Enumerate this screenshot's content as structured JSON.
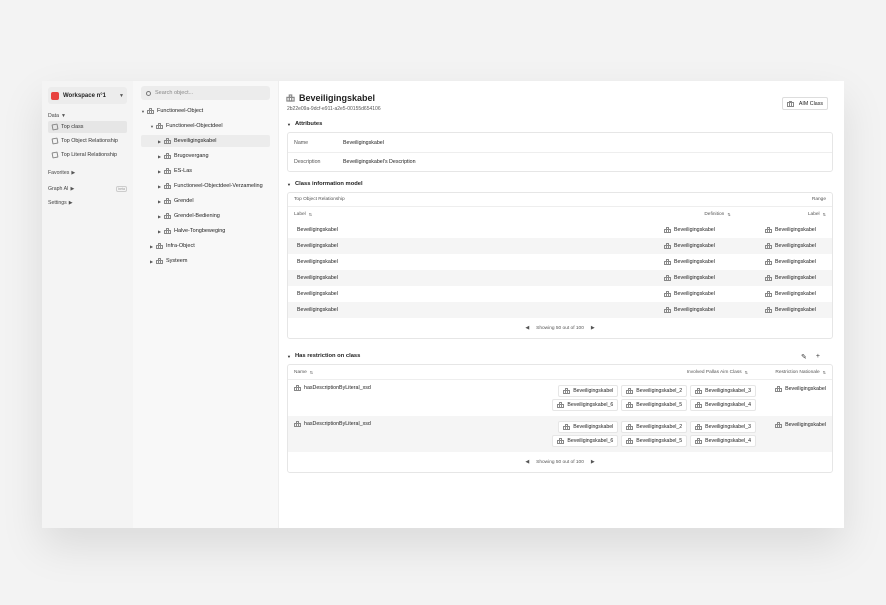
{
  "sidebar": {
    "workspace": "Workspace n°1",
    "data_label": "Data",
    "items": [
      "Top class",
      "Top Object Relationship",
      "Top Literal Relationship"
    ],
    "favorites": "Favorites",
    "graph_ai": "Graph AI",
    "graph_ai_badge": "beta",
    "settings": "Settings"
  },
  "tree": {
    "search_placeholder": "Search object...",
    "root": "Functioneel-Object",
    "child": "Functioneel-Objectdeel",
    "leaves": [
      "Beveiligingskabel",
      "Brugovergang",
      "ES-Las",
      "Functioneel-Objectdeel-Verzameling",
      "Grendel",
      "Grendel-Bediening",
      "Halve-Tongbeweging"
    ],
    "siblings": [
      "Infra-Object",
      "Systeem"
    ]
  },
  "main": {
    "title": "Beveiligingskabel",
    "uuid": "2b22e09a-9dcf-e911-a2e5-00155d654106",
    "aim_button": "AIM Class",
    "attributes": {
      "heading": "Attributes",
      "name_key": "Name",
      "name_val": "Beveiligingskabel",
      "desc_key": "Description",
      "desc_val": "Beveiligingskabel's Description"
    },
    "cim": {
      "heading": "Class information model",
      "sub_left": "Top Object Relationship",
      "sub_right": "Range",
      "col_label": "Label",
      "col_definition": "Definition",
      "col_label2": "Label",
      "rows": [
        [
          "Beveiligingskabel",
          "Beveiligingskabel",
          "Beveiligingskabel"
        ],
        [
          "Beveiligingskabel",
          "Beveiligingskabel",
          "Beveiligingskabel"
        ],
        [
          "Beveiligingskabel",
          "Beveiligingskabel",
          "Beveiligingskabel"
        ],
        [
          "Beveiligingskabel",
          "Beveiligingskabel",
          "Beveiligingskabel"
        ],
        [
          "Beveiligingskabel",
          "Beveiligingskabel",
          "Beveiligingskabel"
        ],
        [
          "Beveiligingskabel",
          "Beveiligingskabel",
          "Beveiligingskabel"
        ]
      ],
      "pager": "Showing 50 out of 100"
    },
    "restriction": {
      "heading": "Has restriction on class",
      "col_name": "Name",
      "col_involved": "Involved Pallas Aim Class",
      "col_rn": "Restriction Nationale",
      "rows": [
        {
          "name": "hasDescriptionByLiteral_xsd",
          "line1": [
            "Beveiligingskabel",
            "Beveiligingskabel_2",
            "Beveiligingskabel_3"
          ],
          "line2": [
            "Beveiligingskabel_6",
            "Beveiligingskabel_5",
            "Beveiligingskabel_4"
          ],
          "rn": "Beveiligingskabel"
        },
        {
          "name": "hasDescriptionByLiteral_xsd",
          "line1": [
            "Beveiligingskabel",
            "Beveiligingskabel_2",
            "Beveiligingskabel_3"
          ],
          "line2": [
            "Beveiligingskabel_6",
            "Beveiligingskabel_5",
            "Beveiligingskabel_4"
          ],
          "rn": "Beveiligingskabel"
        }
      ],
      "pager": "Showing 50 out of 100"
    }
  }
}
